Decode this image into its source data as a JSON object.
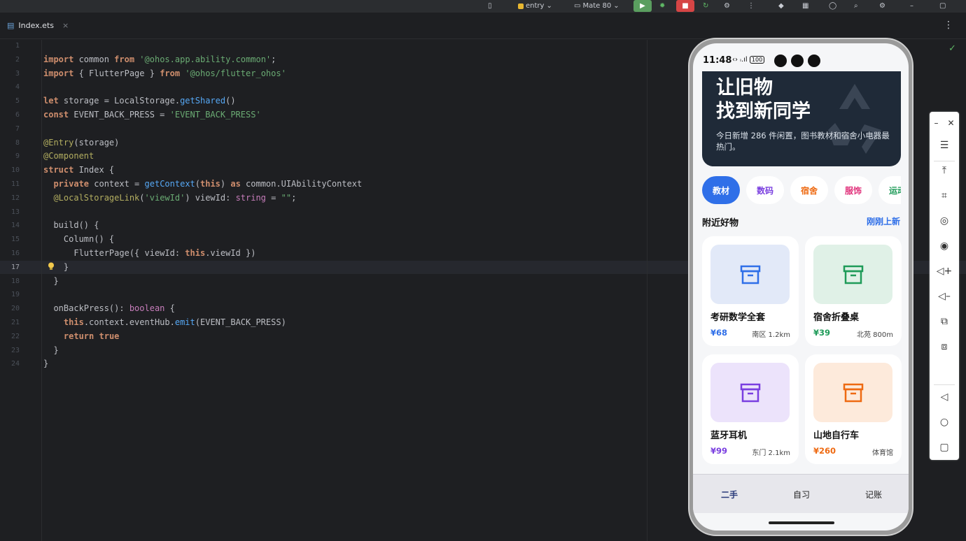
{
  "toolbar": {
    "module": "entry",
    "device": "Mate 80"
  },
  "tab": {
    "filename": "Index.ets",
    "close": "×"
  },
  "editor": {
    "current_line": 17,
    "lines": [
      "",
      "import common from '@ohos.app.ability.common';",
      "import { FlutterPage } from '@ohos/flutter_ohos'",
      "",
      "let storage = LocalStorage.getShared()",
      "const EVENT_BACK_PRESS = 'EVENT_BACK_PRESS'",
      "",
      "@Entry(storage)",
      "@Component",
      "struct Index {",
      "  private context = getContext(this) as common.UIAbilityContext",
      "  @LocalStorageLink('viewId') viewId: string = \"\";",
      "",
      "  build() {",
      "    Column() {",
      "      FlutterPage({ viewId: this.viewId })",
      "    }",
      "  }",
      "",
      "  onBackPress(): boolean {",
      "    this.context.eventHub.emit(EVENT_BACK_PRESS)",
      "    return true",
      "  }",
      "}"
    ]
  },
  "phone": {
    "time": "11:48",
    "hero": {
      "title_line1": "让旧物",
      "title_line2": "找到新同学",
      "subtitle": "今日新增 286 件闲置，图书教材和宿舍小电器最热门。"
    },
    "chips": [
      {
        "label": "教材",
        "color": "#ffffff",
        "bg": "#2f6fe8"
      },
      {
        "label": "数码",
        "color": "#7a3fe0",
        "bg": "#ffffff"
      },
      {
        "label": "宿舍",
        "color": "#ee6a12",
        "bg": "#ffffff"
      },
      {
        "label": "服饰",
        "color": "#e0307a",
        "bg": "#ffffff"
      },
      {
        "label": "运动",
        "color": "#1f9b59",
        "bg": "#ffffff"
      }
    ],
    "section_title": "附近好物",
    "section_link": "刚刚上新",
    "products": [
      {
        "name": "考研数学全套",
        "price": "¥68",
        "location": "南区 1.2km",
        "accent": "#2f6fe8",
        "thumb": "#e2e9f8"
      },
      {
        "name": "宿舍折叠桌",
        "price": "¥39",
        "location": "北苑 800m",
        "accent": "#1f9b59",
        "thumb": "#e0f1e7"
      },
      {
        "name": "蓝牙耳机",
        "price": "¥99",
        "location": "东门 2.1km",
        "accent": "#7a3fe0",
        "thumb": "#ece3fb"
      },
      {
        "name": "山地自行车",
        "price": "¥260",
        "location": "体育馆",
        "accent": "#ee6a12",
        "thumb": "#fdeadb"
      }
    ],
    "nav": [
      "二手",
      "自习",
      "记账"
    ]
  }
}
